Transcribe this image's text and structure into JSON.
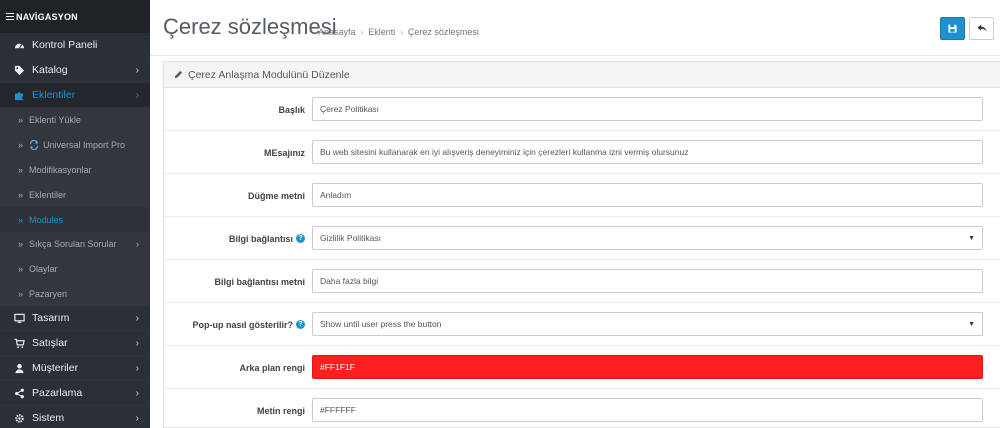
{
  "sidebar": {
    "nav_title": "NAVİGASYON",
    "items": [
      {
        "label": "Kontrol Paneli",
        "icon": "dashboard-icon",
        "chevron": ""
      },
      {
        "label": "Katalog",
        "icon": "tag-icon",
        "chevron": "›"
      },
      {
        "label": "Eklentiler",
        "icon": "puzzle-icon",
        "chevron": "›"
      }
    ],
    "sub_items": [
      {
        "label": "Eklenti Yükle"
      },
      {
        "label": "Universal Import Pro"
      },
      {
        "label": "Modifikasyonlar"
      },
      {
        "label": "Eklentiler"
      },
      {
        "label": "Modules"
      },
      {
        "label": "Sıkça Sorulan Sorular",
        "chevron": "›"
      },
      {
        "label": "Olaylar"
      },
      {
        "label": "Pazaryeri"
      }
    ],
    "bottom_items": [
      {
        "label": "Tasarım",
        "icon": "desktop-icon",
        "chevron": "›"
      },
      {
        "label": "Satışlar",
        "icon": "cart-icon",
        "chevron": "›"
      },
      {
        "label": "Müşteriler",
        "icon": "user-icon",
        "chevron": "›"
      },
      {
        "label": "Pazarlama",
        "icon": "share-icon",
        "chevron": "›"
      },
      {
        "label": "Sistem",
        "icon": "cog-icon",
        "chevron": "›"
      }
    ]
  },
  "header": {
    "title": "Çerez sözleşmesi",
    "breadcrumb": [
      "Anasayfa",
      "Eklenti",
      "Çerez sözleşmesi"
    ],
    "sep": "›"
  },
  "panel": {
    "heading": "Çerez Anlaşma Modulünü Düzenle"
  },
  "form": {
    "baslik": {
      "label": "Başlık",
      "value": "Çerez Politikası"
    },
    "mesaj": {
      "label": "MEsajınız",
      "value": "Bu web sitesini kullanarak en iyi alışveriş deneyiminiz için çerezleri kullanma izni vermiş olursunuz"
    },
    "dugme": {
      "label": "Düğme metni",
      "value": "Anladım"
    },
    "bilgi_baglantisi": {
      "label": "Bilgi bağlantısı",
      "value": "Gizlilik Politikası",
      "help": "?"
    },
    "bilgi_metni": {
      "label": "Bilgi bağlantısı metni",
      "value": "Daha fazla bilgi"
    },
    "popup": {
      "label": "Pop-up nasıl gösterilir?",
      "value": "Show until user press the button",
      "help": "?"
    },
    "arka_plan": {
      "label": "Arka plan rengi",
      "value": "#FF1F1F"
    },
    "metin_rengi": {
      "label": "Metin rengi",
      "value": "#FFFFFF"
    }
  },
  "colors": {
    "accent": "#1e91cf",
    "sidebar_bg": "#2b2f36",
    "swatch_red": "#ff1f1f"
  }
}
